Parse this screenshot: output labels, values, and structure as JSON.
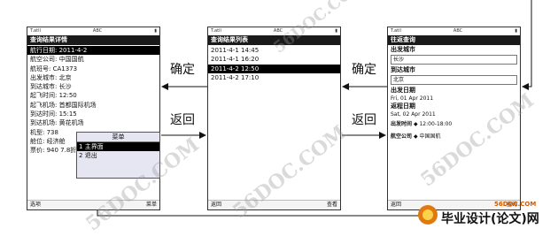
{
  "watermarks": [
    "56DOC.COM",
    "56DOC.COM",
    "56DOC.COM",
    "56DOC.COM"
  ],
  "left": {
    "status_signal": "T.atll",
    "status_center": "ABC",
    "title": "查询结果详情",
    "rows": [
      {
        "text": "航行日期: 2011-4-2",
        "selected": true
      },
      {
        "text": "航空公司: 中国国航",
        "selected": false
      },
      {
        "text": "航班号: CA1373",
        "selected": false
      },
      {
        "text": "出发城市: 北京",
        "selected": false
      },
      {
        "text": "到达城市: 长沙",
        "selected": false
      },
      {
        "text": "起飞时间: 12:50",
        "selected": false
      },
      {
        "text": "起飞机场: 首都国际机场",
        "selected": false
      },
      {
        "text": "到达时间: 15:15",
        "selected": false
      },
      {
        "text": "到达机场: 黄花机场",
        "selected": false
      },
      {
        "text": "机型: 738",
        "selected": false
      },
      {
        "text": "舱位: 经济舱",
        "selected": false
      },
      {
        "text": "票价: 940 7.8折",
        "selected": false
      }
    ],
    "menu": {
      "title": "菜单",
      "items": [
        {
          "num": "1",
          "label": "主界面",
          "selected": true
        },
        {
          "num": "2",
          "label": "退出",
          "selected": false
        }
      ]
    },
    "softkey_left": "选项",
    "softkey_right": "菜单"
  },
  "middle": {
    "status_signal": "T.atll",
    "status_center": "ABC",
    "title": "查询结果列表",
    "rows": [
      {
        "text": "2011-4-1 14:45",
        "selected": false
      },
      {
        "text": "2011-4-1 16:20",
        "selected": false
      },
      {
        "text": "2011-4-2 12:50",
        "selected": true
      },
      {
        "text": "2011-4-2 17:10",
        "selected": false
      }
    ],
    "softkey_left": "返回",
    "softkey_right": "查看"
  },
  "right": {
    "status_signal": "T.atll",
    "status_center": "ABC",
    "title": "往返查询",
    "from_label": "出发城市",
    "from_value": "长沙",
    "to_label": "到达城市",
    "to_value": "北京",
    "depart_label": "出发日期",
    "depart_value": "Fri, 01 Apr 2011",
    "return_label": "返程日期",
    "return_value": "Sat, 02 Apr 2011",
    "time_label": "出发时间",
    "time_value": "12:00-18:00",
    "airline_label": "航空公司",
    "airline_value": "中国国航",
    "softkey_left": "返回",
    "softkey_right": "查询"
  },
  "arrows": {
    "confirm1": "确定",
    "back1": "返回",
    "confirm2": "确定",
    "back2": "返回"
  },
  "logo": {
    "text": "毕业设计(论文)网",
    "site": "56DOC.COM"
  }
}
